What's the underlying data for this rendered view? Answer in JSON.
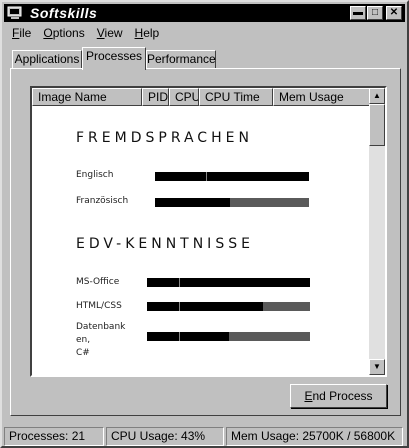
{
  "window": {
    "title": "Softskills"
  },
  "menubar": {
    "items": [
      {
        "label": "File",
        "ul": "F",
        "rest": "ile"
      },
      {
        "label": "Options",
        "ul": "O",
        "rest": "ptions"
      },
      {
        "label": "View",
        "ul": "V",
        "rest": "iew"
      },
      {
        "label": "Help",
        "ul": "H",
        "rest": "elp"
      }
    ]
  },
  "tabs": [
    {
      "label": "Applications"
    },
    {
      "label": "Processes",
      "active": true
    },
    {
      "label": "Performance"
    }
  ],
  "columns": [
    "Image Name",
    "PID",
    "CPU",
    "CPU Time",
    "Mem Usage"
  ],
  "cv": {
    "languages": {
      "heading": "FREMDSPRACHEN",
      "skills": [
        {
          "label": "Englisch",
          "level": 1.0
        },
        {
          "label": "Französisch",
          "level": 0.49
        }
      ]
    },
    "it": {
      "heading": "EDV-KENNTNISSE",
      "skills": [
        {
          "label": "MS-Office",
          "level": 1.0
        },
        {
          "label": "HTML/CSS",
          "level": 0.71
        },
        {
          "label": "Datenbanken,\nC#",
          "label_lines": [
            "Datenbank",
            "en,",
            "C#"
          ],
          "level": 0.5
        }
      ]
    }
  },
  "buttons": {
    "end_process": "End Process",
    "end_process_ul": "E",
    "end_process_rest": "nd Process"
  },
  "status": {
    "processes": "Processes: 21",
    "cpu": "CPU Usage: 43%",
    "mem": "Mem Usage: 25700K / 56800K"
  },
  "colors": {
    "bar_fill": "#000000",
    "bar_track": "#5a5a5a",
    "title_bg": "#000000",
    "face": "#c0c0c0"
  },
  "icons": {
    "app": "taskmgr-icon",
    "minimize": "minimize-icon",
    "maximize": "maximize-icon",
    "close": "close-icon"
  }
}
